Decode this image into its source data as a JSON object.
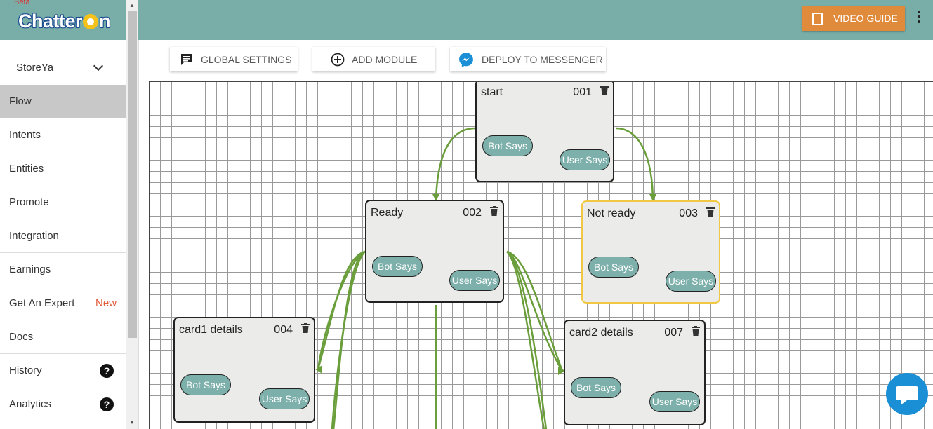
{
  "brand": {
    "beta": "Beta",
    "name_prefix": "Chatter",
    "name_suffix": "n"
  },
  "sidebar": {
    "store": "StoreYa",
    "items": [
      {
        "label": "Flow"
      },
      {
        "label": "Intents"
      },
      {
        "label": "Entities"
      },
      {
        "label": "Promote"
      },
      {
        "label": "Integration"
      },
      {
        "label": "Earnings"
      },
      {
        "label": "Get An Expert",
        "badge": "New"
      },
      {
        "label": "Docs"
      },
      {
        "label": "History",
        "help": "?"
      },
      {
        "label": "Analytics",
        "help": "?"
      }
    ]
  },
  "header": {
    "video_guide": "VIDEO GUIDE"
  },
  "toolbar": {
    "global_settings": "GLOBAL SETTINGS",
    "add_module": "ADD MODULE",
    "deploy": "DEPLOY TO MESSENGER"
  },
  "nodes": [
    {
      "title": "start",
      "id": "001",
      "bot": "Bot Says",
      "user": "User Says"
    },
    {
      "title": "Ready",
      "id": "002",
      "bot": "Bot Says",
      "user": "User Says"
    },
    {
      "title": "Not ready",
      "id": "003",
      "bot": "Bot Says",
      "user": "User Says"
    },
    {
      "title": "card1 details",
      "id": "004",
      "bot": "Bot Says",
      "user": "User Says"
    },
    {
      "title": "card2 details",
      "id": "007",
      "bot": "Bot Says",
      "user": "User Says"
    }
  ],
  "colors": {
    "accent": "#79aea8",
    "edge": "#6a9e3a",
    "video_button": "#e08a3c",
    "messenger": "#1a8fd6",
    "selected_border": "#f2c744"
  }
}
